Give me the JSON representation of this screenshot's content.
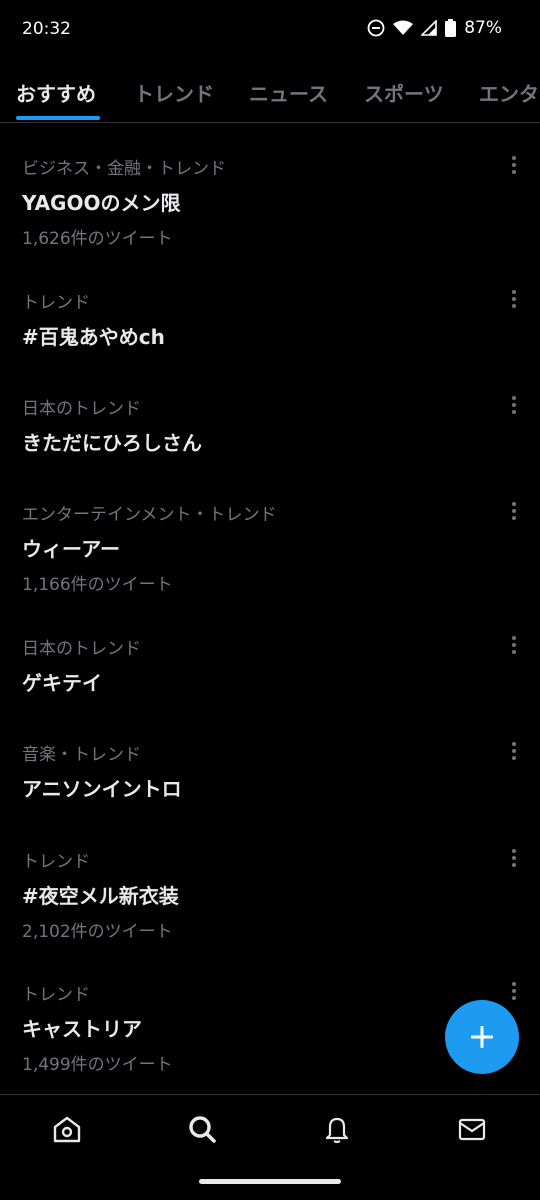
{
  "status_bar": {
    "time": "20:32",
    "battery": "87%"
  },
  "tabs": [
    {
      "label": "おすすめ",
      "active": true
    },
    {
      "label": "トレンド",
      "active": false
    },
    {
      "label": "ニュース",
      "active": false
    },
    {
      "label": "スポーツ",
      "active": false
    },
    {
      "label": "エンタ",
      "active": false
    }
  ],
  "trends": [
    {
      "category": "ビジネス・金融・トレンド",
      "title": "YAGOOのメン限",
      "count": "1,626件のツイート"
    },
    {
      "category": "トレンド",
      "title": "#百鬼あやめch",
      "count": ""
    },
    {
      "category": "日本のトレンド",
      "title": "きただにひろしさん",
      "count": ""
    },
    {
      "category": "エンターテインメント・トレンド",
      "title": "ウィーアー",
      "count": "1,166件のツイート"
    },
    {
      "category": "日本のトレンド",
      "title": "ゲキテイ",
      "count": ""
    },
    {
      "category": "音楽・トレンド",
      "title": "アニソンイントロ",
      "count": ""
    },
    {
      "category": "トレンド",
      "title": "#夜空メル新衣装",
      "count": "2,102件のツイート"
    },
    {
      "category": "トレンド",
      "title": "キャストリア",
      "count": "1,499件のツイート"
    }
  ],
  "colors": {
    "accent": "#1d9bf0",
    "background": "#000000",
    "secondary_text": "#71767b",
    "primary_text": "#e7e9ea"
  },
  "icons": {
    "status": [
      "do-not-disturb-icon",
      "wifi-icon",
      "signal-icon",
      "battery-icon"
    ],
    "bottom_nav": [
      "home-icon",
      "search-icon",
      "bell-icon",
      "mail-icon"
    ],
    "fab": "plus-icon",
    "trend_menu": "more-vertical-icon"
  }
}
